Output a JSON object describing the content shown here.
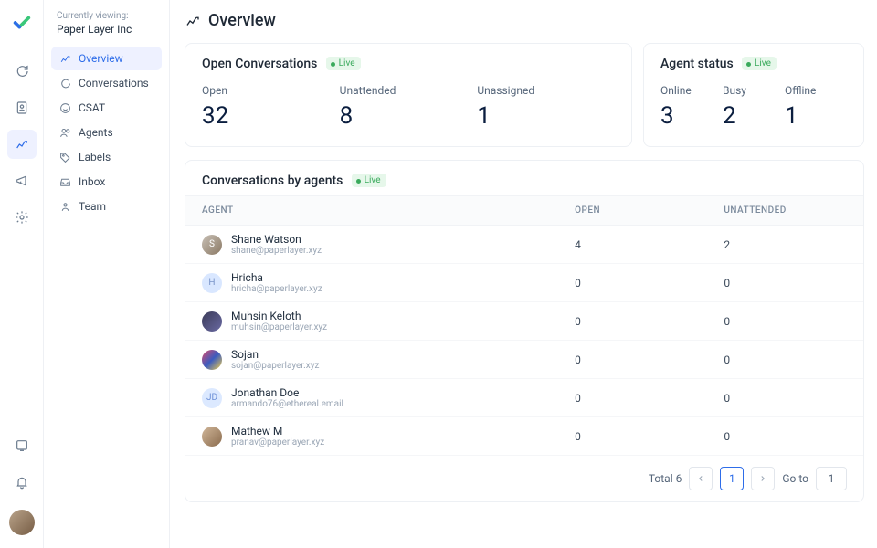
{
  "sidebar": {
    "currently_viewing_label": "Currently viewing:",
    "workspace_name": "Paper Layer Inc",
    "items": [
      {
        "label": "Overview"
      },
      {
        "label": "Conversations"
      },
      {
        "label": "CSAT"
      },
      {
        "label": "Agents"
      },
      {
        "label": "Labels"
      },
      {
        "label": "Inbox"
      },
      {
        "label": "Team"
      }
    ]
  },
  "page": {
    "title": "Overview"
  },
  "open_conversations": {
    "title": "Open Conversations",
    "live": "Live",
    "stats": [
      {
        "label": "Open",
        "value": "32"
      },
      {
        "label": "Unattended",
        "value": "8"
      },
      {
        "label": "Unassigned",
        "value": "1"
      }
    ]
  },
  "agent_status": {
    "title": "Agent status",
    "live": "Live",
    "stats": [
      {
        "label": "Online",
        "value": "3"
      },
      {
        "label": "Busy",
        "value": "2"
      },
      {
        "label": "Offline",
        "value": "1"
      }
    ]
  },
  "conv_by_agents": {
    "title": "Conversations by agents",
    "live": "Live",
    "columns": {
      "agent": "AGENT",
      "open": "OPEN",
      "unattended": "UNATTENDED"
    },
    "rows": [
      {
        "name": "Shane Watson",
        "email": "shane@paperlayer.xyz",
        "open": "4",
        "unattended": "2",
        "initial": "S",
        "avclass": ""
      },
      {
        "name": "Hricha",
        "email": "hricha@paperlayer.xyz",
        "open": "0",
        "unattended": "0",
        "initial": "H",
        "avclass": "h"
      },
      {
        "name": "Muhsin Keloth",
        "email": "muhsin@paperlayer.xyz",
        "open": "0",
        "unattended": "0",
        "initial": "",
        "avclass": "m"
      },
      {
        "name": "Sojan",
        "email": "sojan@paperlayer.xyz",
        "open": "0",
        "unattended": "0",
        "initial": "",
        "avclass": "s"
      },
      {
        "name": "Jonathan Doe",
        "email": "armando76@ethereal.email",
        "open": "0",
        "unattended": "0",
        "initial": "JD",
        "avclass": "j"
      },
      {
        "name": "Mathew M",
        "email": "pranav@paperlayer.xyz",
        "open": "0",
        "unattended": "0",
        "initial": "",
        "avclass": "mm"
      }
    ]
  },
  "pagination": {
    "total_label": "Total 6",
    "current": "1",
    "goto_label": "Go to",
    "goto_value": "1"
  }
}
